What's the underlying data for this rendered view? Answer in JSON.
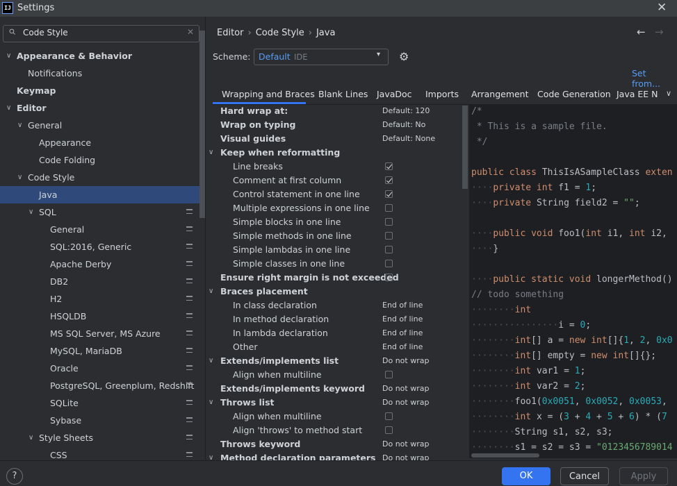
{
  "window": {
    "logo": "IJ",
    "title": "Settings",
    "close": "✕"
  },
  "search": {
    "value": "Code Style",
    "clear": "✕"
  },
  "tree": [
    {
      "label": "Appearance & Behavior",
      "arrow": "∨",
      "bold": true
    },
    {
      "label": "Notifications"
    },
    {
      "label": "Keymap",
      "bold": true
    },
    {
      "label": "Editor",
      "arrow": "∨",
      "bold": true
    },
    {
      "label": "General",
      "arrow": "∨"
    },
    {
      "label": "Appearance"
    },
    {
      "label": "Code Folding"
    },
    {
      "label": "Code Style",
      "arrow": "∨"
    },
    {
      "label": "Java",
      "selected": true
    },
    {
      "label": "SQL",
      "arrow": "∨",
      "project": true
    },
    {
      "label": "General",
      "project": true
    },
    {
      "label": "SQL:2016, Generic",
      "project": true
    },
    {
      "label": "Apache Derby",
      "project": true
    },
    {
      "label": "DB2",
      "project": true
    },
    {
      "label": "H2",
      "project": true
    },
    {
      "label": "HSQLDB",
      "project": true
    },
    {
      "label": "MS SQL Server, MS Azure",
      "project": true
    },
    {
      "label": "MySQL, MariaDB",
      "project": true
    },
    {
      "label": "Oracle",
      "project": true
    },
    {
      "label": "PostgreSQL, Greenplum, Redshift",
      "project": true
    },
    {
      "label": "SQLite",
      "project": true
    },
    {
      "label": "Sybase",
      "project": true
    },
    {
      "label": "Style Sheets",
      "arrow": "∨",
      "project": true
    },
    {
      "label": "CSS",
      "project": true
    }
  ],
  "breadcrumb": [
    "Editor",
    "Code Style",
    "Java"
  ],
  "nav": {
    "back": "←",
    "forward": "→"
  },
  "scheme": {
    "label": "Scheme:",
    "value": "Default",
    "kind": "IDE",
    "arrow": "▾",
    "gear": "⚙"
  },
  "set_from": "Set from...",
  "tabs": [
    "Wrapping and Braces",
    "Blank Lines",
    "JavaDoc",
    "Imports",
    "Arrangement",
    "Code Generation",
    "Java EE N"
  ],
  "tabs_more": "∨",
  "options": [
    {
      "label": "Hard wrap at:",
      "bold": true,
      "value": "Default: 120"
    },
    {
      "label": "Wrap on typing",
      "bold": true,
      "value": "Default: No"
    },
    {
      "label": "Visual guides",
      "bold": true,
      "value": "Default: None"
    },
    {
      "label": "Keep when reformatting",
      "bold": true,
      "arrow": "∨"
    },
    {
      "label": "Line breaks",
      "indent": true,
      "checked": true
    },
    {
      "label": "Comment at first column",
      "indent": true,
      "checked": true
    },
    {
      "label": "Control statement in one line",
      "indent": true,
      "checked": true
    },
    {
      "label": "Multiple expressions in one line",
      "indent": true,
      "checked": false
    },
    {
      "label": "Simple blocks in one line",
      "indent": true,
      "checked": false
    },
    {
      "label": "Simple methods in one line",
      "indent": true,
      "checked": false
    },
    {
      "label": "Simple lambdas in one line",
      "indent": true,
      "checked": false
    },
    {
      "label": "Simple classes in one line",
      "indent": true,
      "checked": false
    },
    {
      "label": "Ensure right margin is not exceeded",
      "bold": true,
      "checked": false
    },
    {
      "label": "Braces placement",
      "bold": true,
      "arrow": "∨"
    },
    {
      "label": "In class declaration",
      "indent": true,
      "value": "End of line"
    },
    {
      "label": "In method declaration",
      "indent": true,
      "value": "End of line"
    },
    {
      "label": "In lambda declaration",
      "indent": true,
      "value": "End of line"
    },
    {
      "label": "Other",
      "indent": true,
      "value": "End of line"
    },
    {
      "label": "Extends/implements list",
      "bold": true,
      "arrow": "∨",
      "value": "Do not wrap"
    },
    {
      "label": "Align when multiline",
      "indent": true,
      "checked": false
    },
    {
      "label": "Extends/implements keyword",
      "bold": true,
      "value": "Do not wrap"
    },
    {
      "label": "Throws list",
      "bold": true,
      "arrow": "∨",
      "value": "Do not wrap"
    },
    {
      "label": "Align when multiline",
      "indent": true,
      "checked": false
    },
    {
      "label": "Align 'throws' to method start",
      "indent": true,
      "checked": false
    },
    {
      "label": "Throws keyword",
      "bold": true,
      "value": "Do not wrap"
    },
    {
      "label": "Method declaration parameters",
      "bold": true,
      "arrow": "∨",
      "value": "Do not wrap"
    }
  ],
  "code_lines": [
    [
      [
        "cm",
        "/*"
      ]
    ],
    [
      [
        "cm",
        " * This is a sample file."
      ]
    ],
    [
      [
        "cm",
        " */"
      ]
    ],
    [],
    [
      [
        "kw",
        "public class "
      ],
      [
        "",
        "ThisIsASampleClass "
      ],
      [
        "kw",
        "exten"
      ]
    ],
    [
      [
        "ws",
        "····"
      ],
      [
        "kw",
        "private int "
      ],
      [
        "",
        "f1 = "
      ],
      [
        "num",
        "1"
      ],
      [
        "",
        ";"
      ]
    ],
    [
      [
        "ws",
        "····"
      ],
      [
        "kw",
        "private "
      ],
      [
        "",
        "String field2 = "
      ],
      [
        "str",
        "\"\""
      ],
      [
        "",
        ";"
      ]
    ],
    [],
    [
      [
        "ws",
        "····"
      ],
      [
        "kw",
        "public void "
      ],
      [
        "",
        "foo1("
      ],
      [
        "kw",
        "int "
      ],
      [
        "",
        "i1, "
      ],
      [
        "kw",
        "int "
      ],
      [
        "",
        "i2,"
      ]
    ],
    [
      [
        "ws",
        "····"
      ],
      [
        "",
        "}"
      ]
    ],
    [],
    [
      [
        "ws",
        "····"
      ],
      [
        "kw",
        "public static void "
      ],
      [
        "",
        "longerMethod()"
      ]
    ],
    [
      [
        "cm",
        "// todo something"
      ]
    ],
    [
      [
        "ws",
        "········"
      ],
      [
        "kw",
        "int"
      ]
    ],
    [
      [
        "ws",
        "················"
      ],
      [
        "",
        "i = "
      ],
      [
        "num",
        "0"
      ],
      [
        "",
        ";"
      ]
    ],
    [
      [
        "ws",
        "········"
      ],
      [
        "kw",
        "int"
      ],
      [
        "",
        "[] a = "
      ],
      [
        "kw",
        "new int"
      ],
      [
        "",
        "[]{"
      ],
      [
        "num",
        "1"
      ],
      [
        "",
        ", "
      ],
      [
        "num",
        "2"
      ],
      [
        "",
        ", "
      ],
      [
        "num",
        "0x0"
      ]
    ],
    [
      [
        "ws",
        "········"
      ],
      [
        "kw",
        "int"
      ],
      [
        "",
        "[] empty = "
      ],
      [
        "kw",
        "new int"
      ],
      [
        "",
        "[]{};"
      ]
    ],
    [
      [
        "ws",
        "········"
      ],
      [
        "kw",
        "int "
      ],
      [
        "",
        "var1 = "
      ],
      [
        "num",
        "1"
      ],
      [
        "",
        ";"
      ]
    ],
    [
      [
        "ws",
        "········"
      ],
      [
        "kw",
        "int "
      ],
      [
        "",
        "var2 = "
      ],
      [
        "num",
        "2"
      ],
      [
        "",
        ";"
      ]
    ],
    [
      [
        "ws",
        "········"
      ],
      [
        "",
        "foo1("
      ],
      [
        "num",
        "0x0051"
      ],
      [
        "",
        ", "
      ],
      [
        "num",
        "0x0052"
      ],
      [
        "",
        ", "
      ],
      [
        "num",
        "0x0053"
      ],
      [
        "",
        ","
      ]
    ],
    [
      [
        "ws",
        "········"
      ],
      [
        "kw",
        "int "
      ],
      [
        "",
        "x = ("
      ],
      [
        "num",
        "3"
      ],
      [
        "",
        " + "
      ],
      [
        "num",
        "4"
      ],
      [
        "",
        " + "
      ],
      [
        "num",
        "5"
      ],
      [
        "",
        " + "
      ],
      [
        "num",
        "6"
      ],
      [
        "",
        ") * ("
      ],
      [
        "num",
        "7"
      ]
    ],
    [
      [
        "ws",
        "········"
      ],
      [
        "",
        "String s1, s2, s3;"
      ]
    ],
    [
      [
        "ws",
        "········"
      ],
      [
        "",
        "s1 = s2 = s3 = "
      ],
      [
        "str",
        "\"0123456789014"
      ]
    ]
  ],
  "buttons": {
    "help": "?",
    "ok": "OK",
    "cancel": "Cancel",
    "apply": "Apply"
  }
}
